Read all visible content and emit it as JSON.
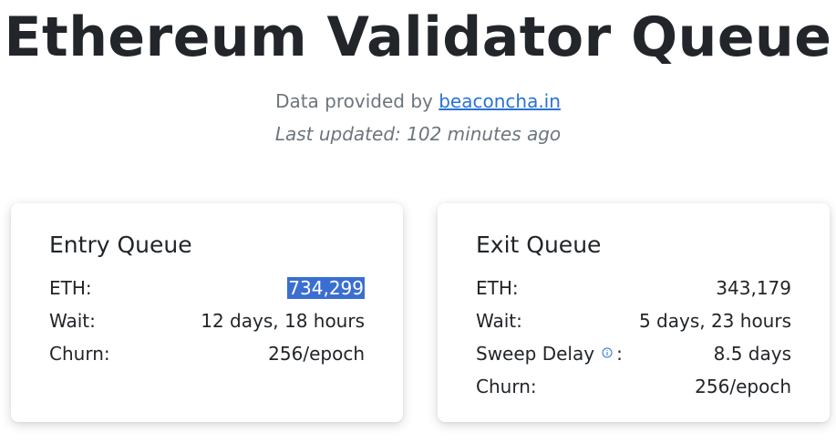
{
  "header": {
    "title": "Ethereum Validator Queue",
    "provided_prefix": "Data provided by",
    "provided_link": "beaconcha.in",
    "last_updated": "Last updated: 102 minutes ago"
  },
  "entry_queue": {
    "title": "Entry Queue",
    "eth_label": "ETH:",
    "eth_value": "734,299",
    "wait_label": "Wait:",
    "wait_value": "12 days, 18 hours",
    "churn_label": "Churn:",
    "churn_value": "256/epoch"
  },
  "exit_queue": {
    "title": "Exit Queue",
    "eth_label": "ETH:",
    "eth_value": "343,179",
    "wait_label": "Wait:",
    "wait_value": "5 days, 23 hours",
    "sweep_label": "Sweep Delay",
    "sweep_colon": ":",
    "sweep_value": "8.5 days",
    "churn_label": "Churn:",
    "churn_value": "256/epoch"
  },
  "colors": {
    "link": "#2a73d6",
    "selection": "#3a6fd1",
    "muted_text": "#6c757d",
    "info_icon": "#2a73d6"
  },
  "icons": {
    "info": "info-circle-icon"
  }
}
